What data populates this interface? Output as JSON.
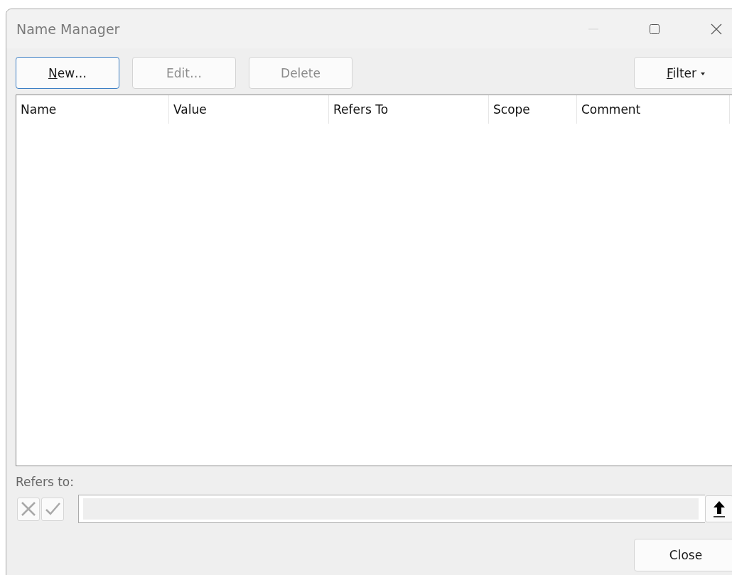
{
  "window": {
    "title": "Name Manager",
    "minimize_disabled": true
  },
  "toolbar": {
    "buttons": [
      {
        "mnemonic": "N",
        "label_rest": "ew…",
        "disabled": false,
        "focused": true
      },
      {
        "label_rest": "Edit…",
        "disabled": true,
        "focused": false
      },
      {
        "label_rest": "Delete",
        "disabled": true,
        "focused": false
      }
    ],
    "filter": {
      "mnemonic": "F",
      "label_rest": "ilter"
    }
  },
  "table": {
    "columns": [
      "Name",
      "Value",
      "Refers To",
      "Scope",
      "Comment"
    ]
  },
  "refers_to": {
    "label": "Refers to:",
    "cancel_disabled": true,
    "confirm_disabled": true,
    "field_disabled": true
  },
  "footer": {
    "buttons": [
      "Close"
    ]
  }
}
